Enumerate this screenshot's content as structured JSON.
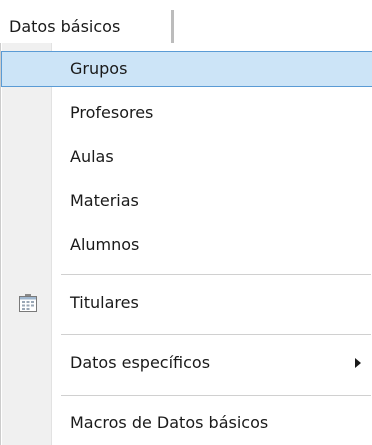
{
  "menu": {
    "title": "Datos básicos"
  },
  "items": {
    "grupos": "Grupos",
    "profesores": "Profesores",
    "aulas": "Aulas",
    "materias": "Materias",
    "alumnos": "Alumnos",
    "titulares": "Titulares",
    "datos_especificos": "Datos específicos",
    "macros": "Macros de Datos básicos"
  },
  "icons": {
    "titulares": "calendar-icon",
    "datos_especificos_arrow": "chevron-right-icon"
  },
  "colors": {
    "highlight_bg": "#cce4f7",
    "highlight_border": "#5a9bd5",
    "gutter": "#f0f0f0"
  }
}
